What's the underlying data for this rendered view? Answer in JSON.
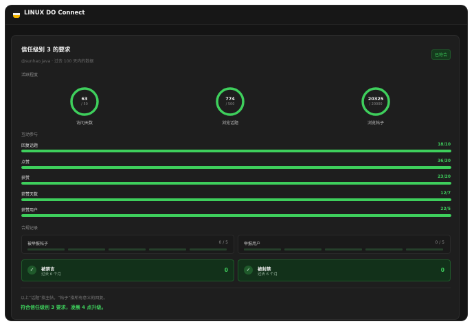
{
  "app": {
    "title": "LINUX DO Connect",
    "logo_colors": [
      "#1c1c1e",
      "#f0f0f0",
      "#f2b300"
    ]
  },
  "card": {
    "title": "信任级别 3 的要求",
    "subtitle": "@sunhao.java · 过去 100 天内的数据",
    "badge": "已符合"
  },
  "activity": {
    "heading": "活跃程度",
    "rings": [
      {
        "value": "63",
        "target": "/ 50",
        "label": "访问天数",
        "progress": 1.0
      },
      {
        "value": "774",
        "target": "/ 500",
        "label": "浏览话题",
        "progress": 1.0
      },
      {
        "value": "20325",
        "target": "/ 20000",
        "label": "浏览帖子",
        "progress": 1.0
      }
    ]
  },
  "interaction": {
    "heading": "互动参与",
    "bars": [
      {
        "label": "回复话题",
        "value": "18/10",
        "progress": 1.0
      },
      {
        "label": "点赞",
        "value": "36/30",
        "progress": 1.0
      },
      {
        "label": "获赞",
        "value": "23/20",
        "progress": 1.0
      },
      {
        "label": "获赞天数",
        "value": "12/7",
        "progress": 1.0
      },
      {
        "label": "获赞用户",
        "value": "22/5",
        "progress": 1.0
      }
    ]
  },
  "compliance": {
    "heading": "合规记录",
    "reports": [
      {
        "label": "被举报帖子",
        "count": "0 / 5"
      },
      {
        "label": "举报用户",
        "count": "0 / 5"
      }
    ],
    "stats": [
      {
        "title": "被禁言",
        "sub": "过去 6 个月",
        "value": "0"
      },
      {
        "title": "被封禁",
        "sub": "过去 6 个月",
        "value": "0"
      }
    ]
  },
  "footer": {
    "note": "以上“话题”指主帖，“帖子”指所有意义的回复。",
    "status": "符合信任级别 3 要求，凌晨 4 点升级。"
  },
  "colors": {
    "accent": "#3ecf5c",
    "background": "#141414",
    "card": "#1e1e1e"
  }
}
